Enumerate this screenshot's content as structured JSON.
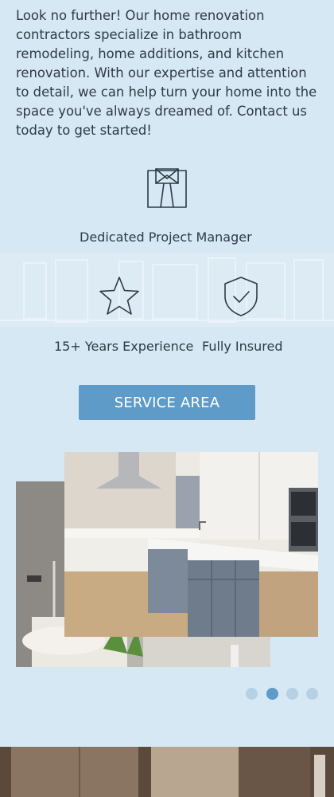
{
  "intro": {
    "text": "Look no further! Our home renovation contractors specialize in bathroom remodeling, home additions, and kitchen renovation. With our expertise and attention to detail, we can help turn your home into the space you've always dreamed of. Contact us today to get started!"
  },
  "features": {
    "project_manager": {
      "label": "Dedicated Project Manager",
      "icon": "project-manager-icon"
    },
    "experience": {
      "label": "15+ Years Experience",
      "icon": "star-icon"
    },
    "insured": {
      "label": "Fully Insured",
      "icon": "shield-check-icon"
    }
  },
  "cta": {
    "label": "SERVICE AREA"
  },
  "gallery": {
    "slide_count": 4,
    "active_slide": 2
  },
  "colors": {
    "background": "#d6e8f4",
    "accent": "#5e9bc8",
    "text": "#2f3a44"
  }
}
